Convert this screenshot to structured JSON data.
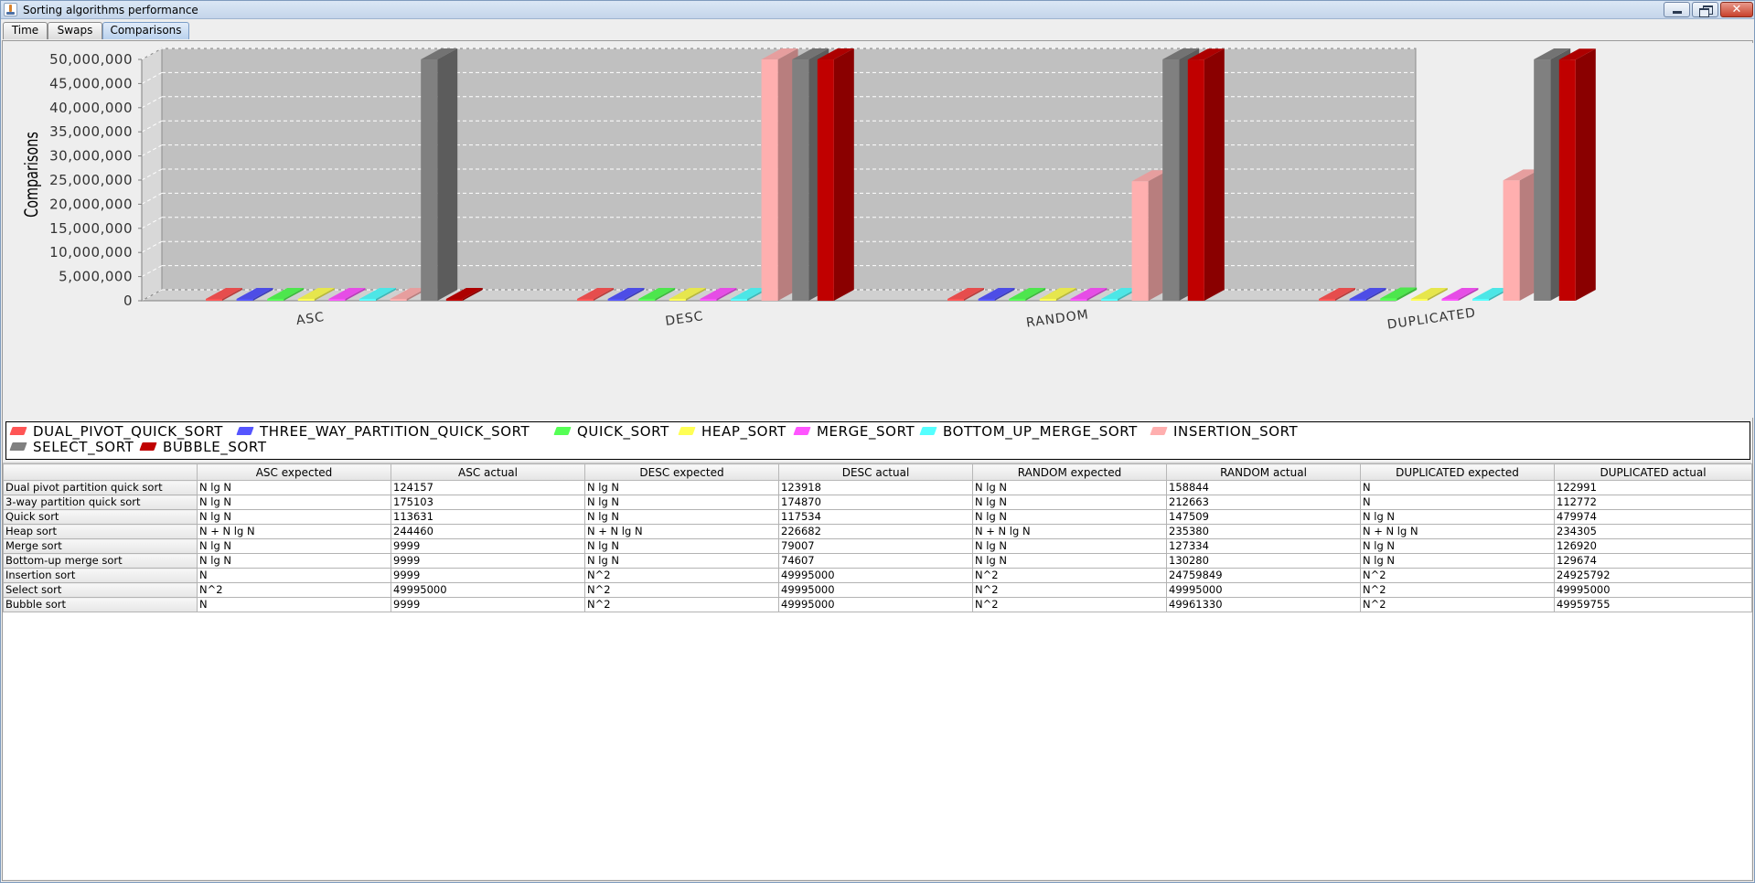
{
  "window": {
    "title": "Sorting algorithms performance"
  },
  "tabs": [
    {
      "label": "Time",
      "active": false
    },
    {
      "label": "Swaps",
      "active": false
    },
    {
      "label": "Comparisons",
      "active": true
    }
  ],
  "chart_data": {
    "type": "bar",
    "ylabel": "Comparisons",
    "ylim": [
      0,
      50000000
    ],
    "yticks": [
      "0",
      "5,000,000",
      "10,000,000",
      "15,000,000",
      "20,000,000",
      "25,000,000",
      "30,000,000",
      "35,000,000",
      "40,000,000",
      "45,000,000",
      "50,000,000"
    ],
    "categories": [
      "ASC",
      "DESC",
      "RANDOM",
      "DUPLICATED"
    ],
    "grid": true,
    "legend": "bottom",
    "series": [
      {
        "name": "DUAL_PIVOT_QUICK_SORT",
        "color": "#ff5555",
        "values": [
          124157,
          123918,
          158844,
          122991
        ]
      },
      {
        "name": "THREE_WAY_PARTITION_QUICK_SORT",
        "color": "#5555ff",
        "values": [
          175103,
          174870,
          212663,
          112772
        ]
      },
      {
        "name": "QUICK_SORT",
        "color": "#55ff55",
        "values": [
          113631,
          117534,
          147509,
          479974
        ]
      },
      {
        "name": "HEAP_SORT",
        "color": "#ffff55",
        "values": [
          244460,
          226682,
          235380,
          234305
        ]
      },
      {
        "name": "MERGE_SORT",
        "color": "#ff55ff",
        "values": [
          9999,
          79007,
          127334,
          126920
        ]
      },
      {
        "name": "BOTTOM_UP_MERGE_SORT",
        "color": "#55ffff",
        "values": [
          9999,
          74607,
          130280,
          129674
        ]
      },
      {
        "name": "INSERTION_SORT",
        "color": "#ffafaf",
        "values": [
          9999,
          49995000,
          24759849,
          24925792
        ]
      },
      {
        "name": "SELECT_SORT",
        "color": "#808080",
        "values": [
          49995000,
          49995000,
          49995000,
          49995000
        ]
      },
      {
        "name": "BUBBLE_SORT",
        "color": "#c00000",
        "values": [
          9999,
          49995000,
          49961330,
          49959755
        ]
      }
    ]
  },
  "table": {
    "corner": "",
    "headers": [
      "ASC expected",
      "ASC actual",
      "DESC expected",
      "DESC actual",
      "RANDOM expected",
      "RANDOM actual",
      "DUPLICATED expected",
      "DUPLICATED actual"
    ],
    "rows": [
      {
        "name": "Dual pivot partition quick sort",
        "cells": [
          "N lg N",
          "124157",
          "N lg N",
          "123918",
          "N lg N",
          "158844",
          "N",
          "122991"
        ]
      },
      {
        "name": "3-way partition quick sort",
        "cells": [
          "N lg N",
          "175103",
          "N lg N",
          "174870",
          "N lg N",
          "212663",
          "N",
          "112772"
        ]
      },
      {
        "name": "Quick sort",
        "cells": [
          "N lg N",
          "113631",
          "N lg N",
          "117534",
          "N lg N",
          "147509",
          "N lg N",
          "479974"
        ]
      },
      {
        "name": "Heap sort",
        "cells": [
          "N + N lg N",
          "244460",
          "N + N lg N",
          "226682",
          "N + N lg N",
          "235380",
          "N + N lg N",
          "234305"
        ]
      },
      {
        "name": "Merge sort",
        "cells": [
          "N lg N",
          "9999",
          "N lg N",
          "79007",
          "N lg N",
          "127334",
          "N lg N",
          "126920"
        ]
      },
      {
        "name": "Bottom-up merge sort",
        "cells": [
          "N lg N",
          "9999",
          "N lg N",
          "74607",
          "N lg N",
          "130280",
          "N lg N",
          "129674"
        ]
      },
      {
        "name": "Insertion sort",
        "cells": [
          "N",
          "9999",
          "N^2",
          "49995000",
          "N^2",
          "24759849",
          "N^2",
          "24925792"
        ]
      },
      {
        "name": "Select sort",
        "cells": [
          "N^2",
          "49995000",
          "N^2",
          "49995000",
          "N^2",
          "49995000",
          "N^2",
          "49995000"
        ]
      },
      {
        "name": "Bubble sort",
        "cells": [
          "N",
          "9999",
          "N^2",
          "49995000",
          "N^2",
          "49961330",
          "N^2",
          "49959755"
        ]
      }
    ]
  }
}
